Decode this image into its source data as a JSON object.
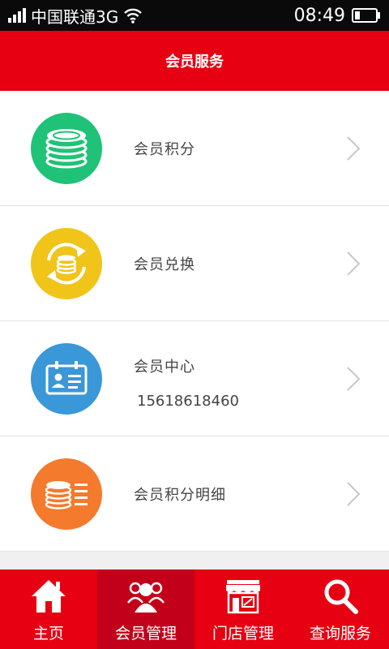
{
  "status_bar": {
    "carrier": "中国联通3G",
    "time": "08:49"
  },
  "header": {
    "title": "会员服务"
  },
  "menu": {
    "items": [
      {
        "label": "会员积分",
        "icon": "coin-stack-icon",
        "color": "#1fc276"
      },
      {
        "label": "会员兑换",
        "icon": "exchange-icon",
        "color": "#f0c419"
      },
      {
        "label": "会员中心",
        "sub": "15618618460",
        "icon": "member-card-icon",
        "color": "#3a97d8"
      },
      {
        "label": "会员积分明细",
        "icon": "points-detail-icon",
        "color": "#f47a2d"
      }
    ]
  },
  "tabbar": {
    "tabs": [
      {
        "label": "主页",
        "icon": "home-icon"
      },
      {
        "label": "会员管理",
        "icon": "members-icon",
        "active": true
      },
      {
        "label": "门店管理",
        "icon": "store-icon"
      },
      {
        "label": "查询服务",
        "icon": "search-icon"
      }
    ]
  },
  "colors": {
    "brand_red": "#e60012",
    "active_tab": "#c3001a"
  }
}
